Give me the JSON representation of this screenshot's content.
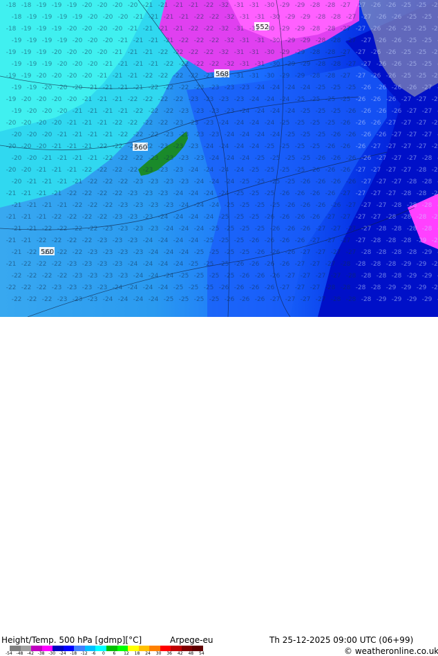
{
  "map": {
    "title": "Height/Temp. 500 hPa [gdmp][°C]",
    "model": "Arpege-eu",
    "valid_time": "Th 25-12-2025 09:00 UTC (06+99)",
    "credit": "© weatheronline.co.uk",
    "height_labels": [
      "560",
      "560",
      "568",
      "552",
      "560",
      "560"
    ],
    "colorbar": {
      "ticks": [
        "-54",
        "-48",
        "-42",
        "-38",
        "-30",
        "-24",
        "-18",
        "-12",
        "-6",
        "0",
        "6",
        "12",
        "18",
        "24",
        "30",
        "36",
        "42",
        "48",
        "54"
      ],
      "colors": [
        "#808080",
        "#a0a0a0",
        "#c000c0",
        "#ff00ff",
        "#0000c0",
        "#0000ff",
        "#4080ff",
        "#00c0ff",
        "#00ffff",
        "#00c000",
        "#00ff00",
        "#ffff00",
        "#ffc000",
        "#ff8000",
        "#ff0000",
        "#c00000",
        "#800000",
        "#600000"
      ]
    },
    "colors": {
      "ocean_cyan": "#40e0e8",
      "light_blue": "#2aa8f0",
      "mid_blue": "#1060ff",
      "deep_blue": "#0010d0",
      "magenta": "#ff00ff",
      "land_green": "#1a8a2a"
    }
  }
}
